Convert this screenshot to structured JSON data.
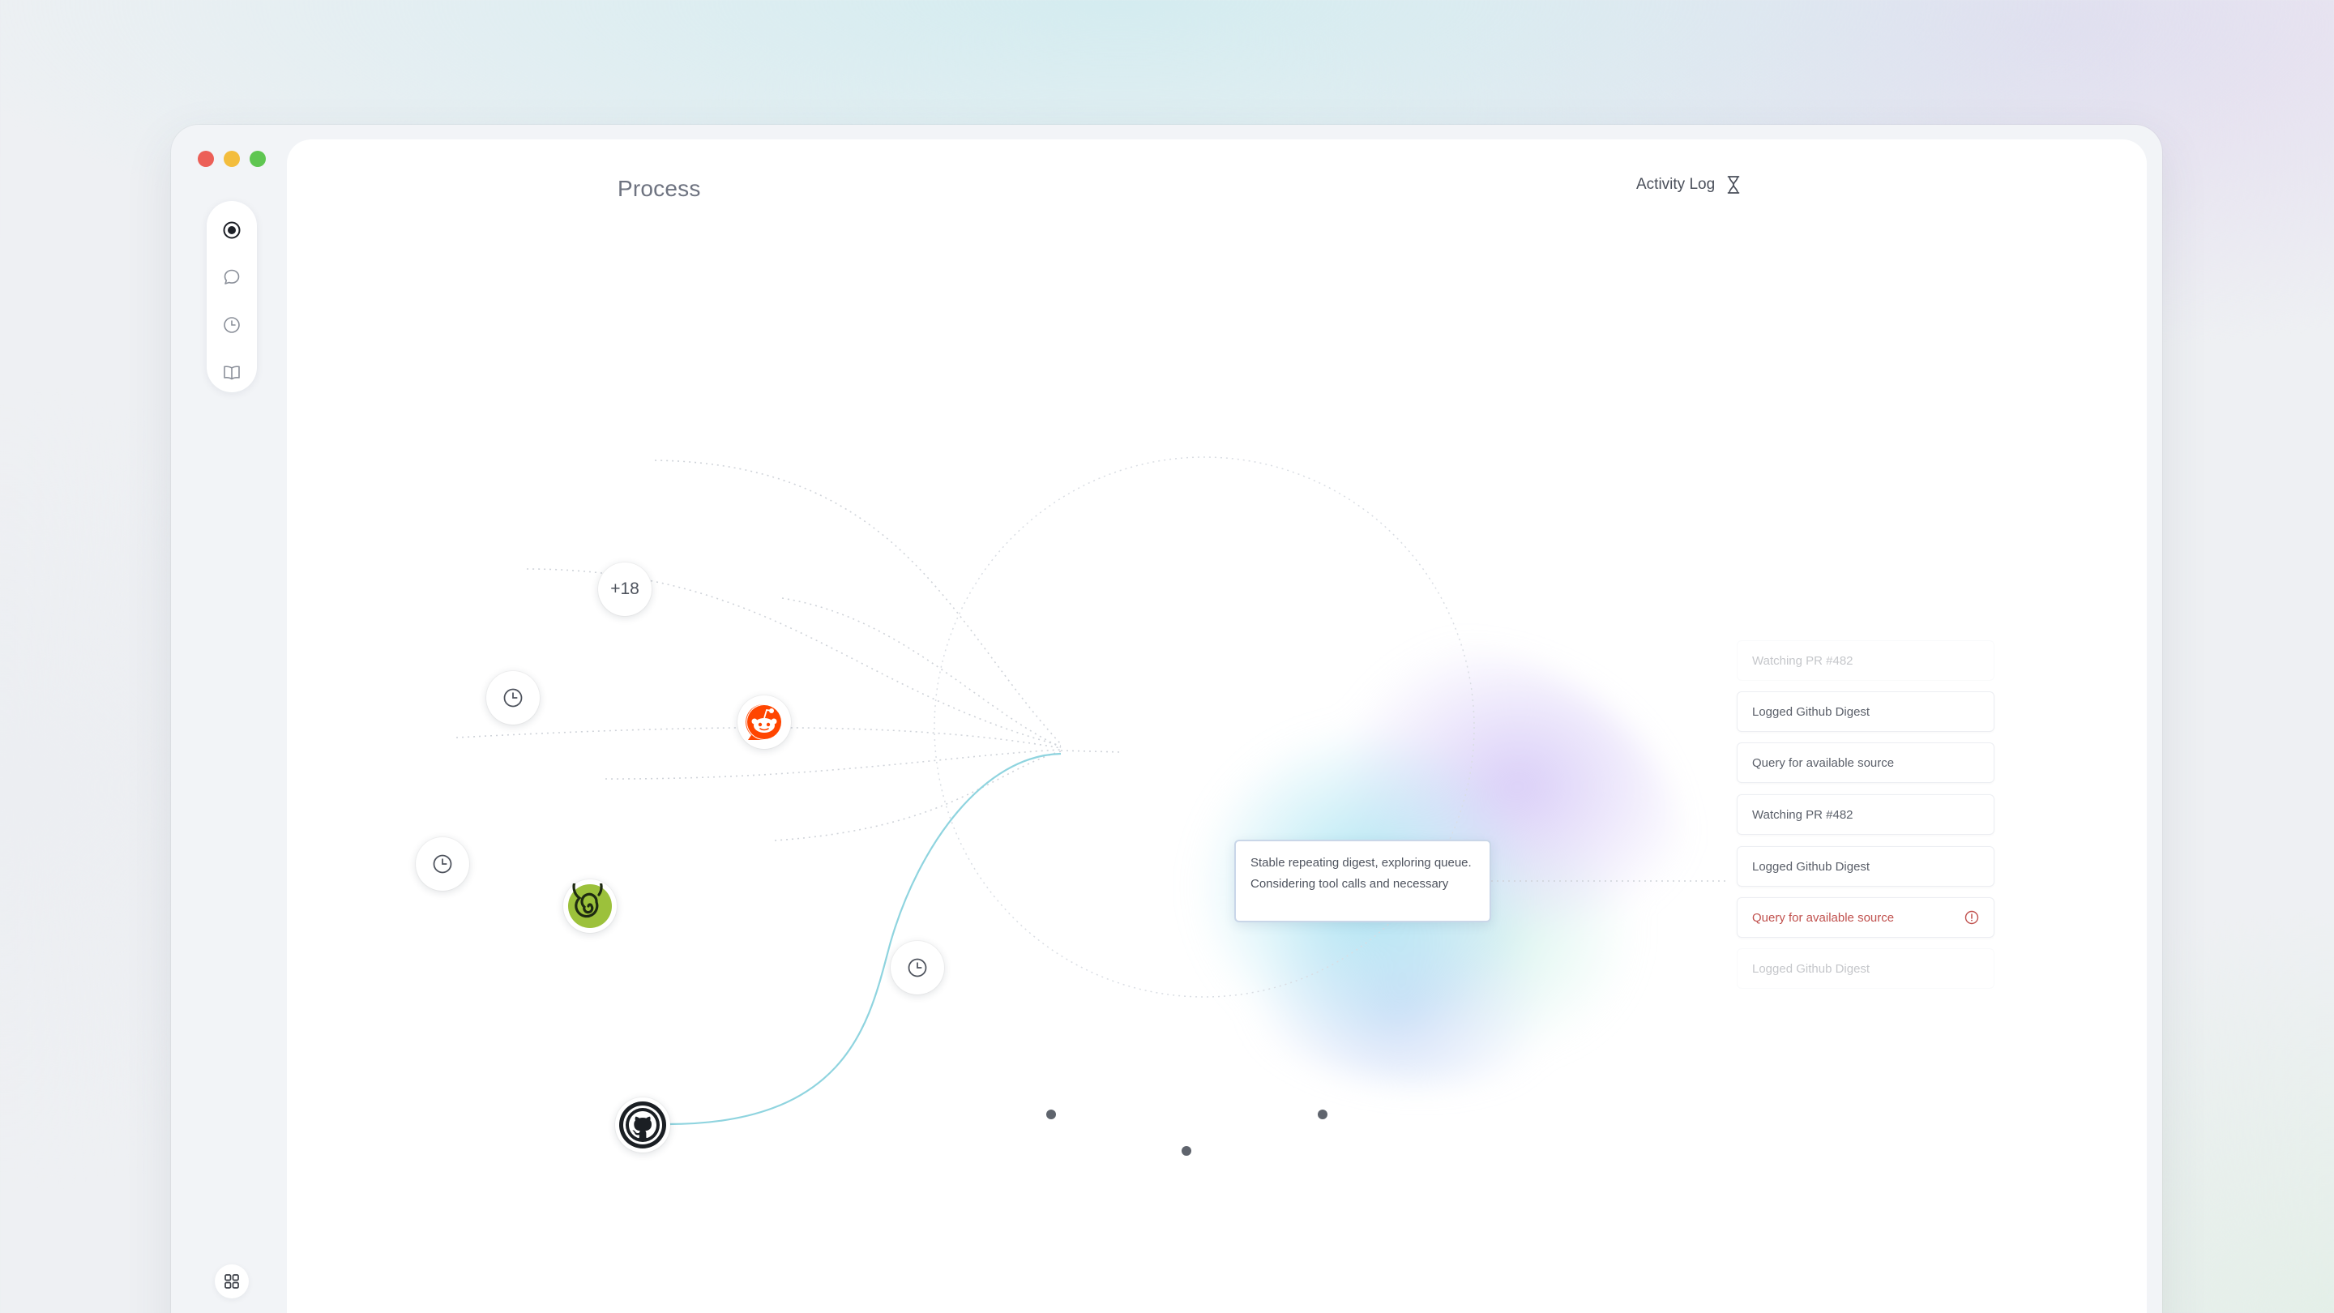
{
  "window": {
    "controls": [
      "close",
      "minimize",
      "zoom"
    ]
  },
  "sidebar": {
    "items": [
      {
        "name": "process",
        "icon": "radio-dot-icon",
        "active": true
      },
      {
        "name": "chat",
        "icon": "chat-bubble-icon",
        "active": false
      },
      {
        "name": "history",
        "icon": "clock-icon",
        "active": false
      },
      {
        "name": "library",
        "icon": "book-icon",
        "active": false
      }
    ],
    "bottom_icon": "grid-icon"
  },
  "header": {
    "title": "Process",
    "activity_log_label": "Activity Log",
    "activity_log_icon": "hourglass-icon"
  },
  "graph": {
    "nodes": [
      {
        "name": "more-sources-node",
        "label": "+18"
      },
      {
        "name": "scheduled-node-1",
        "icon": "clock-icon"
      },
      {
        "name": "reddit-node",
        "icon": "reddit-icon",
        "color": "#ff4500"
      },
      {
        "name": "scheduled-node-2",
        "icon": "clock-icon"
      },
      {
        "name": "spiral-node",
        "icon": "spiral-icon",
        "color": "#9cc13b"
      },
      {
        "name": "scheduled-node-3",
        "icon": "clock-icon"
      },
      {
        "name": "github-node",
        "icon": "github-icon",
        "color": "#1b1f24",
        "active": true
      }
    ],
    "thought": "Stable repeating digest, exploring queue. Considering tool calls and necessary",
    "accent_color": "#7fd3e0"
  },
  "activity_log": {
    "items": [
      {
        "text": "Watching PR #482",
        "state": "faded"
      },
      {
        "text": "Logged Github Digest",
        "state": "normal"
      },
      {
        "text": "Query for available source",
        "state": "normal"
      },
      {
        "text": "Watching PR #482",
        "state": "normal"
      },
      {
        "text": "Logged Github Digest",
        "state": "normal"
      },
      {
        "text": "Query for available source",
        "state": "error"
      },
      {
        "text": "Logged Github Digest",
        "state": "faded"
      }
    ],
    "error_color": "#c0504d"
  }
}
